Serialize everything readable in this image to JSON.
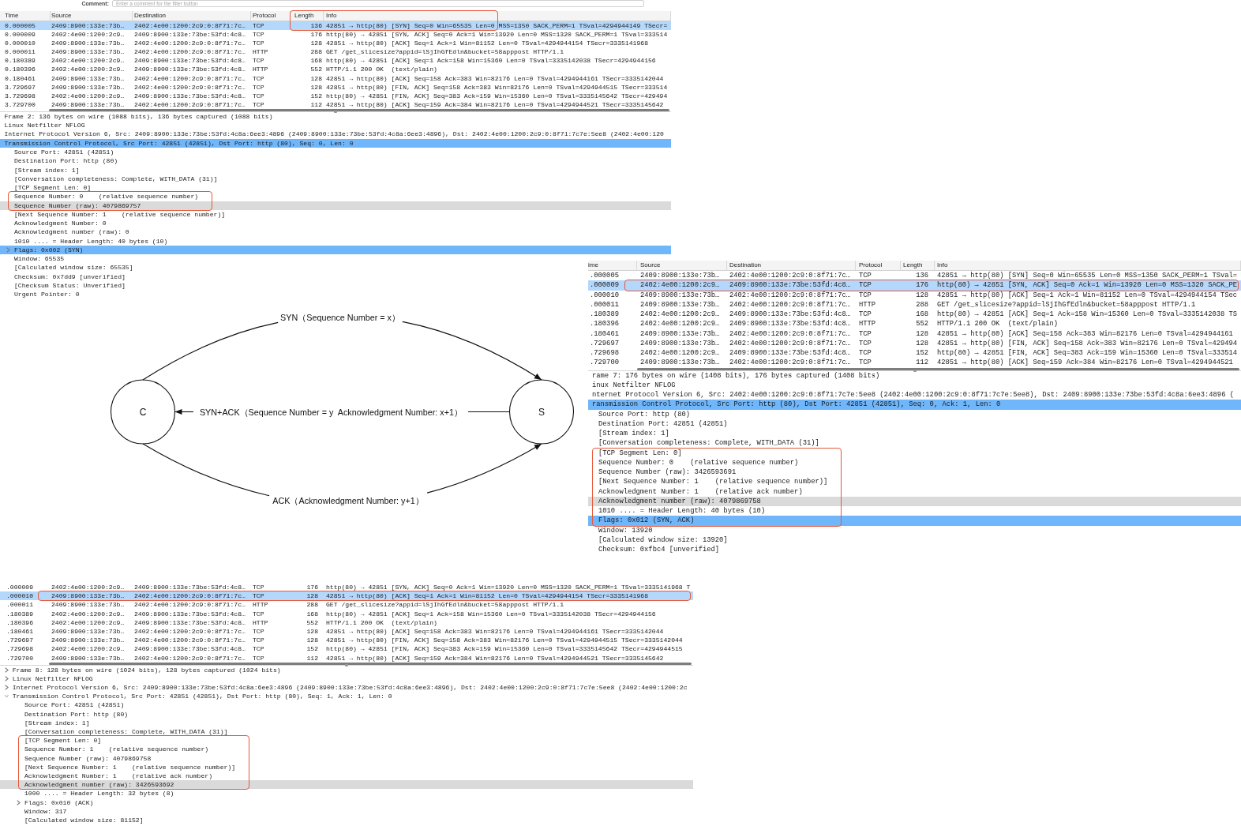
{
  "captures": [
    {
      "comment_bar": {
        "label": "Comment:",
        "placeholder": "Enter a comment for the filter button"
      },
      "packet_list": {
        "columns": [
          "Time",
          "Source",
          "Destination",
          "Protocol",
          "Length",
          "Info"
        ],
        "rows": [
          {
            "kind": "annotation",
            "covers_header": true,
            "full_width": false,
            "rows": [
              {
                "kind": "packet",
                "cells": [
                  "0.000005",
                  "2409:8900:133e:73b…",
                  "2402:4e00:1200:2c9:0:8f71:7c…",
                  "TCP",
                  "136",
                  "42851 → http(80) [SYN] Seq=0 Win=65535 Len=0 MSS=1350 SACK_PERM=1 TSval=4294944149 TSecr="
                ],
                "selected": true
              }
            ]
          },
          {
            "kind": "packet",
            "cells": [
              "0.000009",
              "2402:4e00:1200:2c9…",
              "2409:8900:133e:73be:53fd:4c8…",
              "TCP",
              "176",
              "http(80) → 42851 [SYN, ACK] Seq=0 Ack=1 Win=13920 Len=0 MSS=1320 SACK_PERM=1 TSval=333514"
            ],
            "selected": false
          },
          {
            "kind": "packet",
            "cells": [
              "0.000010",
              "2409:8900:133e:73b…",
              "2402:4e00:1200:2c9:0:8f71:7c…",
              "TCP",
              "128",
              "42851 → http(80) [ACK] Seq=1 Ack=1 Win=81152 Len=0 TSval=4294944154 TSecr=3335141968"
            ],
            "selected": false
          },
          {
            "kind": "packet",
            "cells": [
              "0.000011",
              "2409:8900:133e:73b…",
              "2402:4e00:1200:2c9:0:8f71:7c…",
              "HTTP",
              "288",
              "GET /get_slicesize?appid=lSjIhGfEdln&bucket=58apppost HTTP/1.1"
            ],
            "selected": false
          },
          {
            "kind": "packet",
            "cells": [
              "0.180389",
              "2402:4e00:1200:2c9…",
              "2409:8900:133e:73be:53fd:4c8…",
              "TCP",
              "168",
              "http(80) → 42851 [ACK] Seq=1 Ack=158 Win=15360 Len=0 TSval=3335142038 TSecr=4294944156"
            ],
            "selected": false
          },
          {
            "kind": "packet",
            "cells": [
              "0.180396",
              "2402:4e00:1200:2c9…",
              "2409:8900:133e:73be:53fd:4c8…",
              "HTTP",
              "552",
              "HTTP/1.1 200 OK  (text/plain)"
            ],
            "selected": false
          },
          {
            "kind": "packet",
            "cells": [
              "0.180461",
              "2409:8900:133e:73b…",
              "2402:4e00:1200:2c9:0:8f71:7c…",
              "TCP",
              "128",
              "42851 → http(80) [ACK] Seq=158 Ack=383 Win=82176 Len=0 TSval=4294944161 TSecr=3335142044"
            ],
            "selected": false
          },
          {
            "kind": "packet",
            "cells": [
              "3.729697",
              "2409:8900:133e:73b…",
              "2402:4e00:1200:2c9:0:8f71:7c…",
              "TCP",
              "128",
              "42851 → http(80) [FIN, ACK] Seq=158 Ack=383 Win=82176 Len=0 TSval=4294944515 TSecr=333514"
            ],
            "selected": false
          },
          {
            "kind": "packet",
            "cells": [
              "3.729698",
              "2402:4e00:1200:2c9…",
              "2409:8900:133e:73be:53fd:4c8…",
              "TCP",
              "152",
              "http(80) → 42851 [FIN, ACK] Seq=383 Ack=159 Win=15360 Len=0 TSval=3335145642 TSecr=429494"
            ],
            "selected": false
          },
          {
            "kind": "packet",
            "cells": [
              "3.729700",
              "2409:8900:133e:73b…",
              "2402:4e00:1200:2c9:0:8f71:7c…",
              "TCP",
              "112",
              "42851 → http(80) [ACK] Seq=159 Ack=384 Win=82176 Len=0 TSval=4294944521 TSecr=3335145642"
            ],
            "selected": false
          }
        ]
      },
      "details": [
        {
          "kind": "field",
          "text": "Frame 2: 136 bytes on wire (1088 bits), 136 bytes captured (1088 bits)",
          "selected": false,
          "highlighted": false
        },
        {
          "kind": "field",
          "text": "Linux Netfilter NFLOG",
          "selected": false,
          "highlighted": false
        },
        {
          "kind": "field",
          "text": "Internet Protocol Version 6, Src: 2409:8900:133e:73be:53fd:4c8a:6ee3:4896 (2409:8900:133e:73be:53fd:4c8a:6ee3:4896), Dst: 2402:4e00:1200:2c9:0:8f71:7c7e:5ee8 (2402:4e00:120",
          "selected": false,
          "highlighted": false
        },
        {
          "kind": "field",
          "text": "Transmission Control Protocol, Src Port: 42851 (42851), Dst Port: http (80), Seq: 0, Len: 0",
          "selected": true,
          "highlighted": false,
          "children": [
            {
              "kind": "field",
              "text": "Source Port: 42851 (42851)",
              "selected": false,
              "highlighted": false
            },
            {
              "kind": "field",
              "text": "Destination Port: http (80)",
              "selected": false,
              "highlighted": false
            },
            {
              "kind": "field",
              "text": "[Stream index: 1]",
              "selected": false,
              "highlighted": false
            },
            {
              "kind": "field",
              "text": "[Conversation completeness: Complete, WITH_DATA (31)]",
              "selected": false,
              "highlighted": false
            },
            {
              "kind": "field",
              "text": "[TCP Segment Len: 0]",
              "selected": false,
              "highlighted": false
            },
            {
              "kind": "annotation",
              "rows": [
                {
                  "kind": "field",
                  "text": "Sequence Number: 0    (relative sequence number)",
                  "selected": false,
                  "highlighted": false
                },
                {
                  "kind": "field",
                  "text": "Sequence Number (raw): 4079869757",
                  "selected": false,
                  "highlighted": true
                }
              ]
            },
            {
              "kind": "field",
              "text": "[Next Sequence Number: 1    (relative sequence number)]",
              "selected": false,
              "highlighted": false
            },
            {
              "kind": "field",
              "text": "Acknowledgment Number: 0",
              "selected": false,
              "highlighted": false
            },
            {
              "kind": "field",
              "text": "Acknowledgment number (raw): 0",
              "selected": false,
              "highlighted": false
            },
            {
              "kind": "field",
              "text": "1010 .... = Header Length: 40 bytes (10)",
              "selected": false,
              "highlighted": false
            },
            {
              "kind": "field",
              "text": "Flags: 0x002 (SYN)",
              "selected": true,
              "highlighted": false,
              "expanded": false
            },
            {
              "kind": "field",
              "text": "Window: 65535",
              "selected": false,
              "highlighted": false
            },
            {
              "kind": "field",
              "text": "[Calculated window size: 65535]",
              "selected": false,
              "highlighted": false
            },
            {
              "kind": "field",
              "text": "Checksum: 0x7dd9 [unverified]",
              "selected": false,
              "highlighted": false
            },
            {
              "kind": "field",
              "text": "[Checksum Status: Unverified]",
              "selected": false,
              "highlighted": false
            },
            {
              "kind": "field",
              "text": "Urgent Pointer: 0",
              "selected": false,
              "highlighted": false
            }
          ]
        }
      ]
    },
    {
      "packet_list": {
        "columns": [
          "ime",
          "Source",
          "Destination",
          "Protocol",
          "Length",
          "Info"
        ],
        "rows": [
          {
            "kind": "packet",
            "cells": [
              ".000005",
              "2409:8900:133e:73b…",
              "2402:4e00:1200:2c9:0:8f71:7c…",
              "TCP",
              "136",
              "42851 → http(80) [SYN] Seq=0 Win=65535 Len=0 MSS=1350 SACK_PERM=1 TSval="
            ],
            "selected": false
          },
          {
            "kind": "annotation",
            "covers_header": false,
            "full_width": true,
            "rows": [
              {
                "kind": "packet",
                "cells": [
                  ".000009",
                  "2402:4e00:1200:2c9…",
                  "2409:8900:133e:73be:53fd:4c8…",
                  "TCP",
                  "176",
                  "http(80) → 42851 [SYN, ACK] Seq=0 Ack=1 Win=13920 Len=0 MSS=1320 SACK_PE"
                ],
                "selected": true
              }
            ]
          },
          {
            "kind": "packet",
            "cells": [
              ".000010",
              "2409:8900:133e:73b…",
              "2402:4e00:1200:2c9:0:8f71:7c…",
              "TCP",
              "128",
              "42851 → http(80) [ACK] Seq=1 Ack=1 Win=81152 Len=0 TSval=4294944154 TSec"
            ],
            "selected": false
          },
          {
            "kind": "packet",
            "cells": [
              ".000011",
              "2409:8900:133e:73b…",
              "2402:4e00:1200:2c9:0:8f71:7c…",
              "HTTP",
              "288",
              "GET /get_slicesize?appid=lSjIhGfEdln&bucket=58apppost HTTP/1.1"
            ],
            "selected": false
          },
          {
            "kind": "packet",
            "cells": [
              ".180389",
              "2402:4e00:1200:2c9…",
              "2409:8900:133e:73be:53fd:4c8…",
              "TCP",
              "168",
              "http(80) → 42851 [ACK] Seq=1 Ack=158 Win=15360 Len=0 TSval=3335142038 TS"
            ],
            "selected": false
          },
          {
            "kind": "packet",
            "cells": [
              ".180396",
              "2402:4e00:1200:2c9…",
              "2409:8900:133e:73be:53fd:4c8…",
              "HTTP",
              "552",
              "HTTP/1.1 200 OK  (text/plain)"
            ],
            "selected": false
          },
          {
            "kind": "packet",
            "cells": [
              ".180461",
              "2409:8900:133e:73b…",
              "2402:4e00:1200:2c9:0:8f71:7c…",
              "TCP",
              "128",
              "42851 → http(80) [ACK] Seq=158 Ack=383 Win=82176 Len=0 TSval=4294944161"
            ],
            "selected": false
          },
          {
            "kind": "packet",
            "cells": [
              ".729697",
              "2409:8900:133e:73b…",
              "2402:4e00:1200:2c9:0:8f71:7c…",
              "TCP",
              "128",
              "42851 → http(80) [FIN, ACK] Seq=158 Ack=383 Win=82176 Len=0 TSval=429494"
            ],
            "selected": false
          },
          {
            "kind": "packet",
            "cells": [
              ".729698",
              "2402:4e00:1200:2c9…",
              "2409:8900:133e:73be:53fd:4c8…",
              "TCP",
              "152",
              "http(80) → 42851 [FIN, ACK] Seq=383 Ack=159 Win=15360 Len=0 TSval=333514"
            ],
            "selected": false
          },
          {
            "kind": "packet",
            "cells": [
              ".729700",
              "2409:8900:133e:73b…",
              "2402:4e00:1200:2c9:0:8f71:7c…",
              "TCP",
              "112",
              "42851 → http(80) [ACK] Seq=159 Ack=384 Win=82176 Len=0 TSval=4294944521"
            ],
            "selected": false
          }
        ]
      },
      "details": [
        {
          "kind": "field",
          "text": "rame 7: 176 bytes on wire (1408 bits), 176 bytes captured (1408 bits)",
          "selected": false,
          "highlighted": false
        },
        {
          "kind": "field",
          "text": "inux Netfilter NFLOG",
          "selected": false,
          "highlighted": false
        },
        {
          "kind": "field",
          "text": "nternet Protocol Version 6, Src: 2402:4e00:1200:2c9:0:8f71:7c7e:5ee8 (2402:4e00:1200:2c9:0:8f71:7c7e:5ee8), Dst: 2409:8900:133e:73be:53fd:4c8a:6ee3:4896 (",
          "selected": false,
          "highlighted": false
        },
        {
          "kind": "field",
          "text": "ransmission Control Protocol, Src Port: http (80), Dst Port: 42851 (42851), Seq: 0, Ack: 1, Len: 0",
          "selected": true,
          "highlighted": false,
          "children": [
            {
              "kind": "field",
              "text": "Source Port: http (80)",
              "selected": false,
              "highlighted": false
            },
            {
              "kind": "field",
              "text": "Destination Port: 42851 (42851)",
              "selected": false,
              "highlighted": false
            },
            {
              "kind": "field",
              "text": "[Stream index: 1]",
              "selected": false,
              "highlighted": false
            },
            {
              "kind": "field",
              "text": "[Conversation completeness: Complete, WITH_DATA (31)]",
              "selected": false,
              "highlighted": false
            },
            {
              "kind": "annotation",
              "rows": [
                {
                  "kind": "field",
                  "text": "[TCP Segment Len: 0]",
                  "selected": false,
                  "highlighted": false
                },
                {
                  "kind": "field",
                  "text": "Sequence Number: 0    (relative sequence number)",
                  "selected": false,
                  "highlighted": false
                },
                {
                  "kind": "field",
                  "text": "Sequence Number (raw): 3426593691",
                  "selected": false,
                  "highlighted": false
                },
                {
                  "kind": "field",
                  "text": "[Next Sequence Number: 1    (relative sequence number)]",
                  "selected": false,
                  "highlighted": false
                },
                {
                  "kind": "field",
                  "text": "Acknowledgment Number: 1    (relative ack number)",
                  "selected": false,
                  "highlighted": false
                },
                {
                  "kind": "field",
                  "text": "Acknowledgment number (raw): 4079869758",
                  "selected": false,
                  "highlighted": true
                },
                {
                  "kind": "field",
                  "text": "1010 .... = Header Length: 40 bytes (10)",
                  "selected": false,
                  "highlighted": false
                },
                {
                  "kind": "field",
                  "text": "Flags: 0x012 (SYN, ACK)",
                  "selected": true,
                  "highlighted": false
                }
              ]
            },
            {
              "kind": "field",
              "text": "Window: 13920",
              "selected": false,
              "highlighted": false
            },
            {
              "kind": "field",
              "text": "[Calculated window size: 13920]",
              "selected": false,
              "highlighted": false
            },
            {
              "kind": "field",
              "text": "Checksum: 0xfbc4 [unverified]",
              "selected": false,
              "highlighted": false
            }
          ]
        }
      ]
    },
    {
      "packet_list": {
        "rows": [
          {
            "kind": "packet",
            "cells": [
              ".000009",
              "2402:4e00:1200:2c9…",
              "2409:8900:133e:73be:53fd:4c8…",
              "TCP",
              "176",
              "http(80) → 42851 [SYN, ACK] Seq=0 Ack=1 Win=13920 Len=0 MSS=1320 SACK_PERM=1 TSval=3335141968 T"
            ],
            "selected": false
          },
          {
            "kind": "annotation",
            "full_width": true,
            "rows": [
              {
                "kind": "packet",
                "cells": [
                  ".000010",
                  "2409:8900:133e:73b…",
                  "2402:4e00:1200:2c9:0:8f71:7c…",
                  "TCP",
                  "128",
                  "42851 → http(80) [ACK] Seq=1 Ack=1 Win=81152 Len=0 TSval=4294944154 TSecr=3335141968"
                ],
                "selected": true
              }
            ]
          },
          {
            "kind": "packet",
            "cells": [
              ".000011",
              "2409:8900:133e:73b…",
              "2402:4e00:1200:2c9:0:8f71:7c…",
              "HTTP",
              "288",
              "GET /get_slicesize?appid=lSjIhGfEdln&bucket=58apppost HTTP/1.1"
            ],
            "selected": false
          },
          {
            "kind": "packet",
            "cells": [
              ".180389",
              "2402:4e00:1200:2c9…",
              "2409:8900:133e:73be:53fd:4c8…",
              "TCP",
              "168",
              "http(80) → 42851 [ACK] Seq=1 Ack=158 Win=15360 Len=0 TSval=3335142038 TSecr=4294944156"
            ],
            "selected": false
          },
          {
            "kind": "packet",
            "cells": [
              ".180396",
              "2402:4e00:1200:2c9…",
              "2409:8900:133e:73be:53fd:4c8…",
              "HTTP",
              "552",
              "HTTP/1.1 200 OK  (text/plain)"
            ],
            "selected": false
          },
          {
            "kind": "packet",
            "cells": [
              ".180461",
              "2409:8900:133e:73b…",
              "2402:4e00:1200:2c9:0:8f71:7c…",
              "TCP",
              "128",
              "42851 → http(80) [ACK] Seq=158 Ack=383 Win=82176 Len=0 TSval=4294944161 TSecr=3335142044"
            ],
            "selected": false
          },
          {
            "kind": "packet",
            "cells": [
              ".729697",
              "2409:8900:133e:73b…",
              "2402:4e00:1200:2c9:0:8f71:7c…",
              "TCP",
              "128",
              "42851 → http(80) [FIN, ACK] Seq=158 Ack=383 Win=82176 Len=0 TSval=4294944515 TSecr=3335142044"
            ],
            "selected": false
          },
          {
            "kind": "packet",
            "cells": [
              ".729698",
              "2402:4e00:1200:2c9…",
              "2409:8900:133e:73be:53fd:4c8…",
              "TCP",
              "152",
              "http(80) → 42851 [FIN, ACK] Seq=383 Ack=159 Win=15360 Len=0 TSval=3335145642 TSecr=4294944515"
            ],
            "selected": false
          },
          {
            "kind": "packet",
            "cells": [
              ".729700",
              "2409:8900:133e:73b…",
              "2402:4e00:1200:2c9:0:8f71:7c…",
              "TCP",
              "112",
              "42851 → http(80) [ACK] Seq=159 Ack=384 Win=82176 Len=0 TSval=4294944521 TSecr=3335145642"
            ],
            "selected": false
          }
        ]
      },
      "details": [
        {
          "kind": "field",
          "text": "Frame 8: 128 bytes on wire (1024 bits), 128 bytes captured (1024 bits)",
          "selected": false,
          "highlighted": false,
          "expanded": false
        },
        {
          "kind": "field",
          "text": "Linux Netfilter NFLOG",
          "selected": false,
          "highlighted": false,
          "expanded": false
        },
        {
          "kind": "field",
          "text": "Internet Protocol Version 6, Src: 2409:8900:133e:73be:53fd:4c8a:6ee3:4896 (2409:8900:133e:73be:53fd:4c8a:6ee3:4896), Dst: 2402:4e00:1200:2c9:0:8f71:7c7e:5ee8 (2402:4e00:1200:2c",
          "selected": false,
          "highlighted": false,
          "expanded": false
        },
        {
          "kind": "field",
          "text": "Transmission Control Protocol, Src Port: 42851 (42851), Dst Port: http (80), Seq: 1, Ack: 1, Len: 0",
          "selected": false,
          "highlighted": false,
          "expanded": true,
          "children": [
            {
              "kind": "field",
              "text": "Source Port: 42851 (42851)",
              "selected": false,
              "highlighted": false
            },
            {
              "kind": "field",
              "text": "Destination Port: http (80)",
              "selected": false,
              "highlighted": false
            },
            {
              "kind": "field",
              "text": "[Stream index: 1]",
              "selected": false,
              "highlighted": false
            },
            {
              "kind": "field",
              "text": "[Conversation completeness: Complete, WITH_DATA (31)]",
              "selected": false,
              "highlighted": false
            },
            {
              "kind": "annotation",
              "rows": [
                {
                  "kind": "field",
                  "text": "[TCP Segment Len: 0]",
                  "selected": false,
                  "highlighted": false
                },
                {
                  "kind": "field",
                  "text": "Sequence Number: 1    (relative sequence number)",
                  "selected": false,
                  "highlighted": false
                },
                {
                  "kind": "field",
                  "text": "Sequence Number (raw): 4079869758",
                  "selected": false,
                  "highlighted": false
                },
                {
                  "kind": "field",
                  "text": "[Next Sequence Number: 1    (relative sequence number)]",
                  "selected": false,
                  "highlighted": false
                },
                {
                  "kind": "field",
                  "text": "Acknowledgment Number: 1    (relative ack number)",
                  "selected": false,
                  "highlighted": false
                },
                {
                  "kind": "field",
                  "text": "Acknowledgment number (raw): 3426593692",
                  "selected": false,
                  "highlighted": true
                }
              ]
            },
            {
              "kind": "field",
              "text": "1000 .... = Header Length: 32 bytes (8)",
              "selected": false,
              "highlighted": false
            },
            {
              "kind": "field",
              "text": "Flags: 0x010 (ACK)",
              "selected": false,
              "highlighted": false,
              "expanded": false
            },
            {
              "kind": "field",
              "text": "Window: 317",
              "selected": false,
              "highlighted": false
            },
            {
              "kind": "field",
              "text": "[Calculated window size: 81152]",
              "selected": false,
              "highlighted": false
            }
          ]
        }
      ]
    }
  ],
  "handshake_diagram": {
    "nodes": [
      {
        "label": "C"
      },
      {
        "label": "S"
      }
    ],
    "edges": [
      {
        "kind": "upper",
        "toward_client": false,
        "label": "SYN（Sequence Number = x）"
      },
      {
        "kind": "straight",
        "toward_client": true,
        "label": "SYN+ACK（Sequence Number = y  Acknowledgment Number: x+1）"
      },
      {
        "kind": "lower",
        "toward_client": false,
        "label": "ACK（Acknowledgment Number: y+1）"
      }
    ]
  }
}
